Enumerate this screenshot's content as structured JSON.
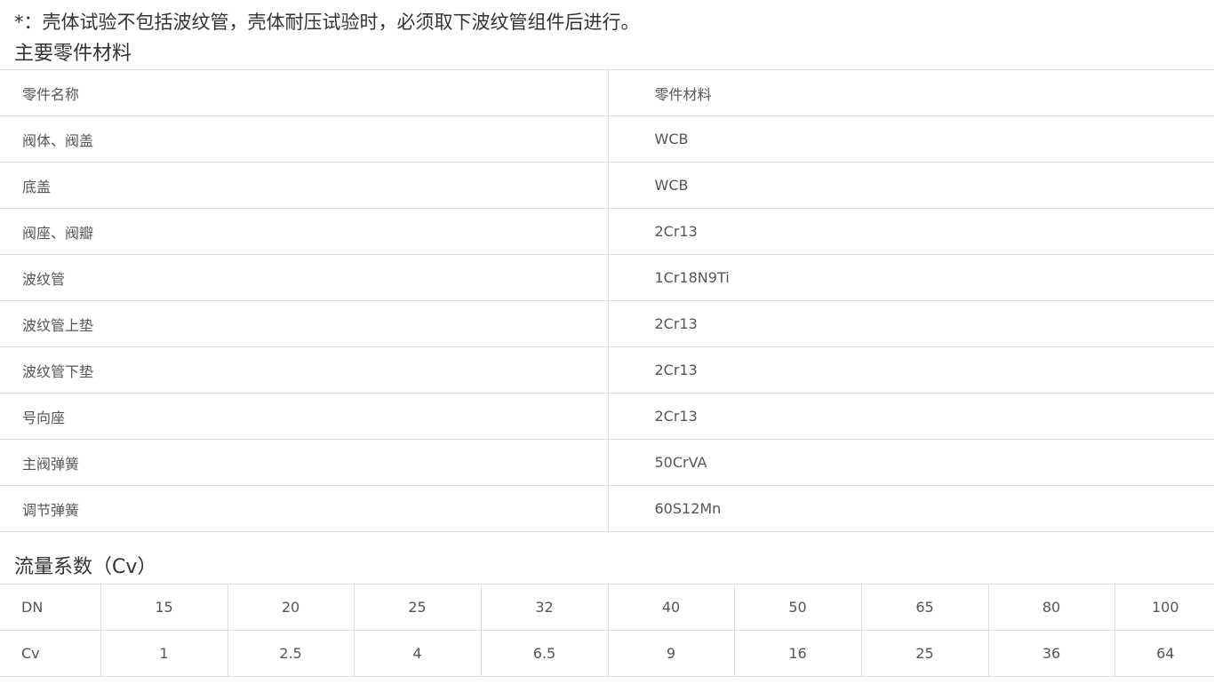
{
  "note": "*：壳体试验不包括波纹管，壳体耐压试验时，必须取下波纹管组件后进行。",
  "materials": {
    "title": "主要零件材料",
    "header": {
      "part": "零件名称",
      "material": "零件材料"
    },
    "rows": [
      {
        "part": "阀体、阀盖",
        "material": "WCB"
      },
      {
        "part": "底盖",
        "material": "WCB"
      },
      {
        "part": "阀座、阀瓣",
        "material": "2Cr13"
      },
      {
        "part": "波纹管",
        "material": "1Cr18N9Ti"
      },
      {
        "part": "波纹管上垫",
        "material": "2Cr13"
      },
      {
        "part": "波纹管下垫",
        "material": "2Cr13"
      },
      {
        "part": "号向座",
        "material": "2Cr13"
      },
      {
        "part": "主阀弹簧",
        "material": "50CrVA"
      },
      {
        "part": "调节弹簧",
        "material": "60S12Mn"
      }
    ]
  },
  "flow": {
    "title": "流量系数（Cv）",
    "dn_label": "DN",
    "cv_label": "Cv",
    "dn": [
      "15",
      "20",
      "25",
      "32",
      "40",
      "50",
      "65",
      "80",
      "100"
    ],
    "cv": [
      "1",
      "2.5",
      "4",
      "6.5",
      "9",
      "16",
      "25",
      "36",
      "64"
    ]
  }
}
